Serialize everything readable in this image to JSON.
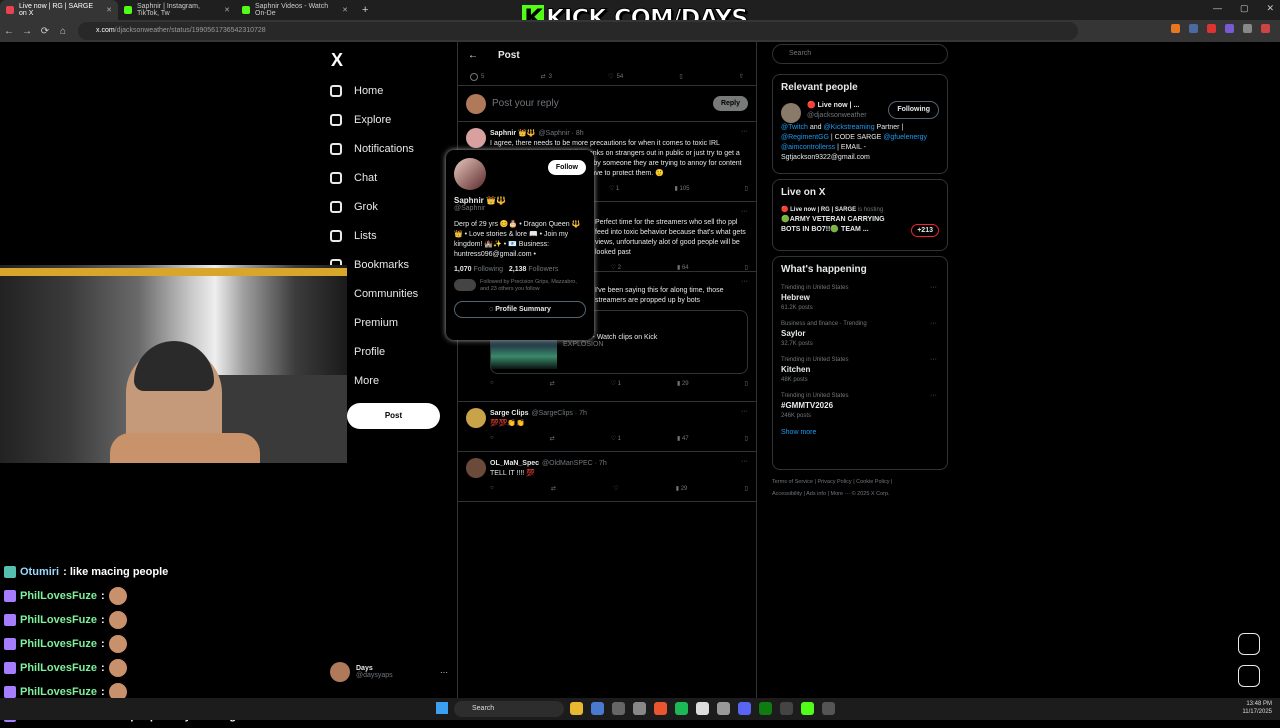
{
  "browser": {
    "tabs": [
      {
        "label": "Live now | RG | SARGE on X",
        "color": "#e8434e",
        "active": true
      },
      {
        "label": "Saphnir | Instagram, TikTok, Tw",
        "color": "#53fc18",
        "active": false
      },
      {
        "label": "Saphnir Videos - Watch On-De",
        "color": "#53fc18",
        "active": false
      }
    ],
    "url_host": "x.com",
    "url_path": "/djacksonweather/status/1990561736542310728",
    "overlay_brand_k": "K",
    "overlay_brand": "KICK.COM/DAYS"
  },
  "sidebar": {
    "logo": "X",
    "items": [
      "Home",
      "Explore",
      "Notifications",
      "Chat",
      "Grok",
      "Lists",
      "Bookmarks",
      "Communities",
      "Premium",
      "Profile",
      "More"
    ],
    "post_button": "Post",
    "account_name": "Days",
    "account_handle": "@daysyaps"
  },
  "main": {
    "header_title": "Post",
    "stats": {
      "replies": "5",
      "reposts": "3",
      "likes": "54"
    },
    "reply_placeholder": "Post your reply",
    "reply_button": "Reply",
    "tweets": [
      {
        "name": "Saphnir 👑🔱",
        "handle": "@Saphnir · 8h",
        "text": "I agree, there needs to be more precautions for when it comes to toxic IRL streamers who go out and do pranks on strangers out in public or just try to get a reaction. Those who get pressed by someone they are trying to annoy for content deserve it, I'm sorry but people have to protect them. 🙂",
        "replies": "1",
        "reposts": "",
        "likes": "105",
        "avatar": "#d9a0a0"
      },
      {
        "name": "",
        "handle": "",
        "text": "Perfect time for the streamers who sell tho ppl feed into toxic behavior because that's what gets views, unfortunately alot of good people will be looked past",
        "replies": "2",
        "reposts": "",
        "likes": "64",
        "avatar": "#555555"
      },
      {
        "name": "",
        "handle": "· 2h",
        "text": "I've been saying this for along time, those streamers are propped up by bots",
        "replies": "1",
        "reposts": "",
        "likes": "29",
        "avatar": "#555555"
      },
      {
        "name": "Sarge Clips",
        "handle": "@SargeClips · 7h",
        "text": "💯💯👏👏",
        "replies": "1",
        "reposts": "",
        "likes": "47",
        "avatar": "#c9a34a"
      },
      {
        "name": "OL_MaN_Spec",
        "handle": "@OldManSPEC · 7h",
        "text": "TELL IT !!!! 💯",
        "replies": "",
        "reposts": "",
        "likes": "29",
        "avatar": "#6b4a3a"
      }
    ],
    "card": {
      "domain": "kick.com",
      "title": "DurkIOG - Watch clips on Kick",
      "subtitle": "EXPLOSION"
    }
  },
  "hovercard": {
    "name": "Saphnir 👑🔱",
    "handle": "@Saphnir",
    "follow": "Follow",
    "bio": "Derp of 29 yrs 😊🎂 • Dragon Queen 🔱👑 • Love stories & lore 📖 • Join my kingdom! 🏰✨ • 📧 Business: huntress096@gmail.com •",
    "following_count": "1,070",
    "following_label": "Following",
    "followers_count": "2,138",
    "followers_label": "Followers",
    "followed_by": "Followed by Precision Grips, Mazzabro, and 23 others you follow",
    "summary_button": "Profile Summary"
  },
  "right": {
    "search_placeholder": "Search",
    "relevant_title": "Relevant people",
    "relevant_name": "🔴 Live now | ...",
    "relevant_handle": "@djacksonweather",
    "relevant_button": "Following",
    "relevant_bio_1": "@Twitch",
    "relevant_bio_2": " and ",
    "relevant_bio_3": "@Kickstreaming",
    "relevant_bio_4": " Partner | ",
    "relevant_bio_5": "@RegimentGG",
    "relevant_bio_6": " | CODE SARGE ",
    "relevant_bio_7": "@gfuelenergy @aimcontrollerss",
    "relevant_bio_8": " | EMAIL - Sgtjackson9322@gmail.com",
    "live_title": "Live on X",
    "live_host": "🔴 Live now | RG | SARGE",
    "live_hosting": "is hosting",
    "live_text": "🟢ARMY VETERAN CARRYING BOTS IN BO7!!🟢 TEAM ...",
    "live_count": "+213",
    "happening_title": "What's happening",
    "trends": [
      {
        "context": "Trending in United States",
        "name": "Hebrew",
        "count": "61.2K posts"
      },
      {
        "context": "Business and finance · Trending",
        "name": "Saylor",
        "count": "32.7K posts"
      },
      {
        "context": "Trending in United States",
        "name": "Kitchen",
        "count": "48K posts"
      },
      {
        "context": "Trending in United States",
        "name": "#GMMTV2026",
        "count": "246K posts"
      }
    ],
    "show_more": "Show more",
    "footer_1": "Terms of Service  |  Privacy Policy  |  Cookie Policy  |",
    "footer_2": "Accessibility  |  Ads info  |  More ···  © 2025 X Corp."
  },
  "chat": [
    {
      "user": "Otumiri",
      "msg": ": like macing people"
    },
    {
      "user": "PhilLovesFuze",
      "msg": ":"
    },
    {
      "user": "PhilLovesFuze",
      "msg": ":"
    },
    {
      "user": "PhilLovesFuze",
      "msg": ":"
    },
    {
      "user": "PhilLovesFuze",
      "msg": ":"
    },
    {
      "user": "PhilLovesFuze",
      "msg": ":"
    },
    {
      "user": "PhilLovesFuze",
      "msg": ": nah people stay woofing on the net"
    }
  ],
  "taskbar": {
    "search": "Search",
    "time": "13:48 PM",
    "date": "11/17/2025"
  }
}
